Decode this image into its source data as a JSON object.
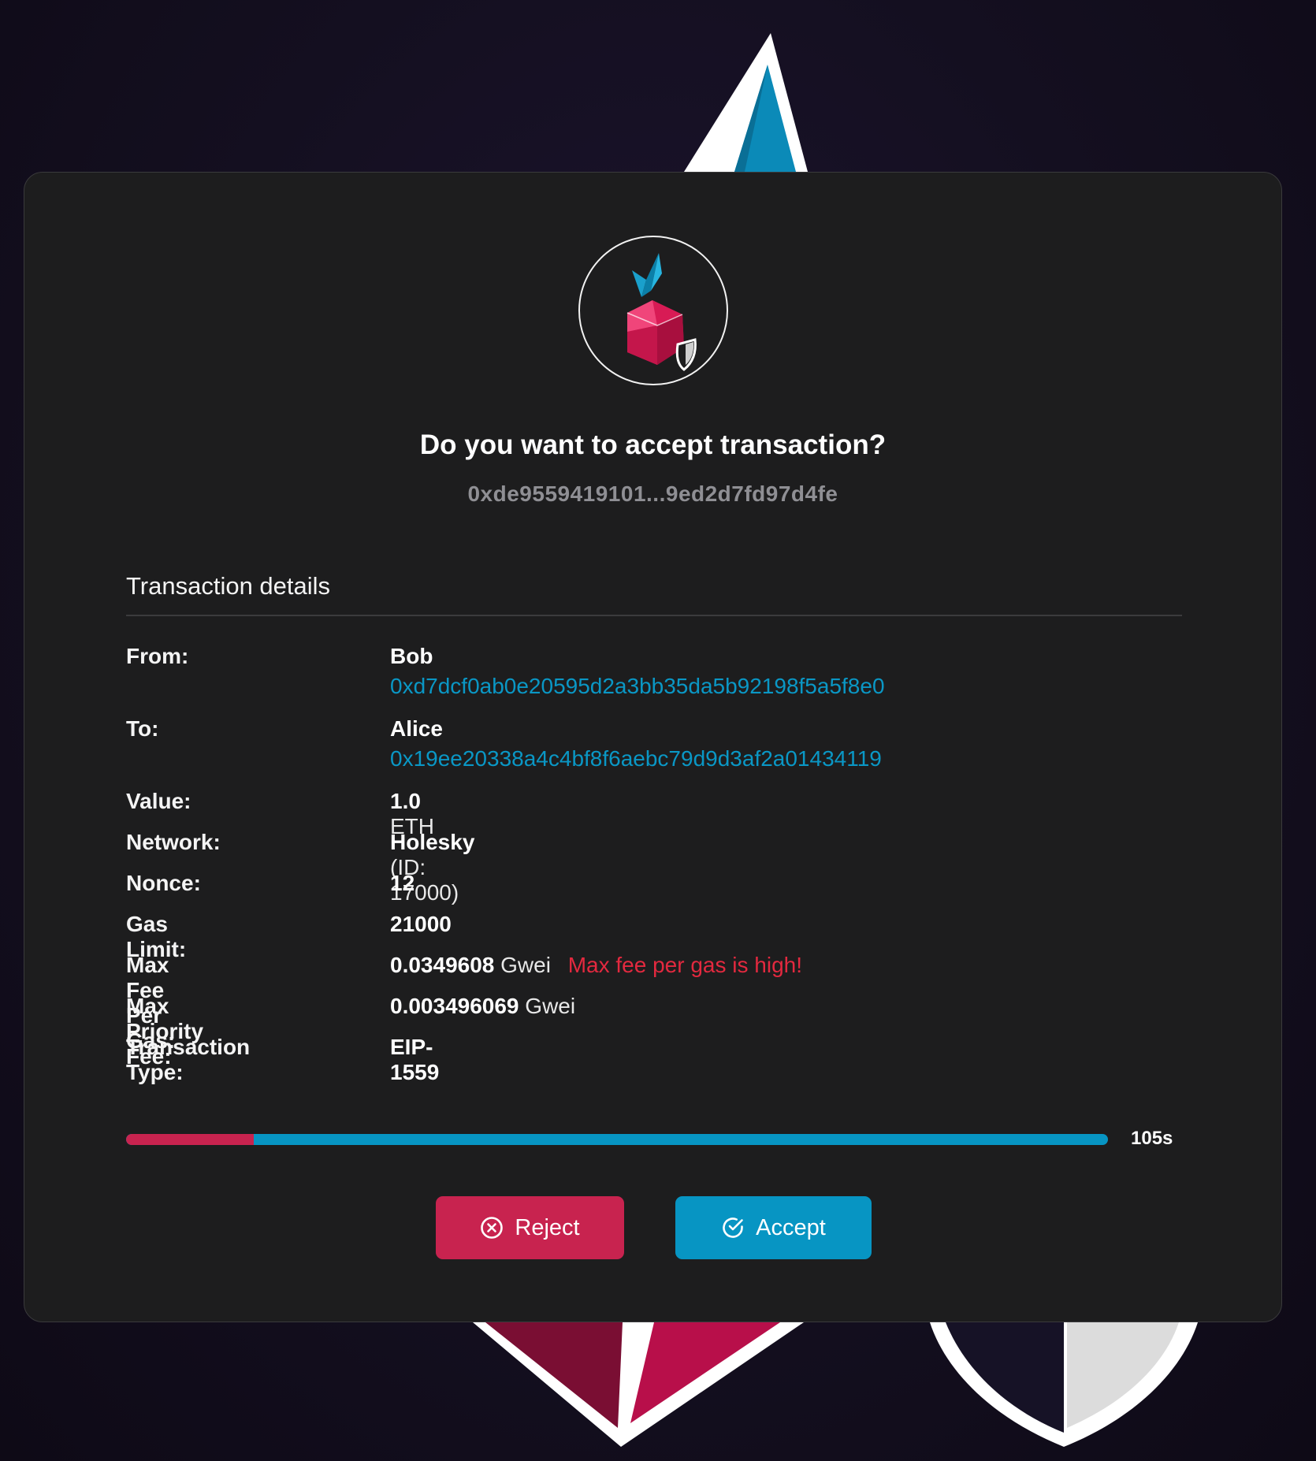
{
  "modal": {
    "title": "Do you want to accept transaction?",
    "tx_hash": "0xde9559419101...9ed2d7fd97d4fe",
    "section_title": "Transaction details"
  },
  "details": {
    "from": {
      "label": "From:",
      "name": "Bob",
      "address": "0xd7dcf0ab0e20595d2a3bb35da5b92198f5a5f8e0"
    },
    "to": {
      "label": "To:",
      "name": "Alice",
      "address": "0x19ee20338a4c4bf8f6aebc79d9d3af2a01434119"
    },
    "value": {
      "label": "Value:",
      "amount": "1.0",
      "unit": "ETH"
    },
    "network": {
      "label": "Network:",
      "name": "Holesky",
      "id_text": "(ID: 17000)"
    },
    "nonce": {
      "label": "Nonce:",
      "value": "12"
    },
    "gas_limit": {
      "label": "Gas Limit:",
      "value": "21000"
    },
    "max_fee": {
      "label": "Max Fee Per Gas:",
      "amount": "0.0349608",
      "unit": "Gwei",
      "warning": "Max fee per gas is high!"
    },
    "max_priority_fee": {
      "label": "Max Priority Fee:",
      "amount": "0.003496069",
      "unit": "Gwei"
    },
    "tx_type": {
      "label": "Transaction Type:",
      "value": "EIP-1559"
    }
  },
  "timer": {
    "text": "105s",
    "elapsed_fraction": 0.13
  },
  "buttons": {
    "reject_label": "Reject",
    "reject_icon": "x-circle-icon",
    "accept_label": "Accept",
    "accept_icon": "check-circle-icon"
  },
  "colors": {
    "accent_blue": "#0795c3",
    "accent_red": "#c8234f",
    "warning_red": "#e3293f",
    "modal_bg": "#1d1d1e"
  }
}
